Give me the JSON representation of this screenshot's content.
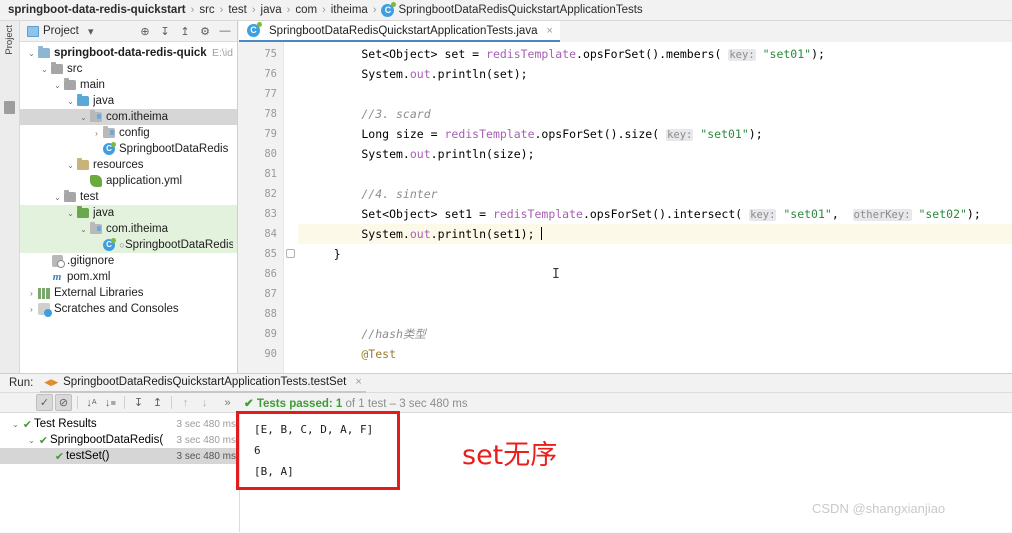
{
  "breadcrumb": {
    "items": [
      {
        "label": "springboot-data-redis-quickstart",
        "bold": true
      },
      {
        "label": "src",
        "bold": false
      },
      {
        "label": "test",
        "bold": false
      },
      {
        "label": "java",
        "bold": false
      },
      {
        "label": "com",
        "bold": false
      },
      {
        "label": "itheima",
        "bold": false
      }
    ],
    "class_icon": "java-class-icon",
    "class_label": "SpringbootDataRedisQuickstartApplicationTests"
  },
  "left_strips": {
    "project_label": "Project",
    "structure_label": "Structure"
  },
  "project_panel": {
    "title": "Project",
    "toolbar": [
      {
        "name": "locate-icon",
        "glyph": "⊕"
      },
      {
        "name": "expand-all-icon",
        "glyph": "↧"
      },
      {
        "name": "collapse-all-icon",
        "glyph": "↥"
      },
      {
        "name": "settings-gear-icon",
        "glyph": "⚙"
      },
      {
        "name": "hide-panel-icon",
        "glyph": "—"
      }
    ],
    "tree": [
      {
        "label": "springboot-data-redis-quickstart",
        "path_suffix": "E:\\id",
        "indent": 0,
        "chev": "v",
        "icon": "module-folder-icon",
        "bold": true,
        "highlight": ""
      },
      {
        "label": "src",
        "indent": 1,
        "chev": "v",
        "icon": "folder-icon",
        "bold": false,
        "highlight": ""
      },
      {
        "label": "main",
        "indent": 2,
        "chev": "v",
        "icon": "folder-icon",
        "bold": false,
        "highlight": ""
      },
      {
        "label": "java",
        "indent": 3,
        "chev": "v",
        "icon": "source-folder-icon",
        "bold": false,
        "highlight": ""
      },
      {
        "label": "com.itheima",
        "indent": 4,
        "chev": "v",
        "icon": "package-icon",
        "bold": false,
        "highlight": "grey"
      },
      {
        "label": "config",
        "indent": 5,
        "chev": ">",
        "icon": "package-icon",
        "bold": false,
        "highlight": ""
      },
      {
        "label": "SpringbootDataRedis",
        "indent": 5,
        "chev": "",
        "icon": "java-class-icon",
        "bold": false,
        "highlight": ""
      },
      {
        "label": "resources",
        "indent": 3,
        "chev": "v",
        "icon": "resources-folder-icon",
        "bold": false,
        "highlight": ""
      },
      {
        "label": "application.yml",
        "indent": 4,
        "chev": "",
        "icon": "yaml-file-icon",
        "bold": false,
        "highlight": ""
      },
      {
        "label": "test",
        "indent": 2,
        "chev": "v",
        "icon": "folder-icon",
        "bold": false,
        "highlight": ""
      },
      {
        "label": "java",
        "indent": 3,
        "chev": "v",
        "icon": "test-source-folder-icon",
        "bold": false,
        "highlight": "green"
      },
      {
        "label": "com.itheima",
        "indent": 4,
        "chev": "v",
        "icon": "package-icon",
        "bold": false,
        "highlight": "green"
      },
      {
        "label": "SpringbootDataRedis",
        "indent": 5,
        "chev": "",
        "icon": "java-test-class-icon",
        "bold": false,
        "highlight": "green"
      },
      {
        "label": ".gitignore",
        "indent": 1,
        "chev": "",
        "icon": "gitignore-file-icon",
        "bold": false,
        "highlight": ""
      },
      {
        "label": "pom.xml",
        "indent": 1,
        "chev": "",
        "icon": "maven-file-icon",
        "bold": false,
        "highlight": ""
      },
      {
        "label": "External Libraries",
        "indent": 0,
        "chev": ">",
        "icon": "library-icon",
        "bold": false,
        "highlight": ""
      },
      {
        "label": "Scratches and Consoles",
        "indent": 0,
        "chev": ">",
        "icon": "scratches-icon",
        "bold": false,
        "highlight": ""
      }
    ]
  },
  "editor": {
    "tab_label": "SpringbootDataRedisQuickstartApplicationTests.java",
    "tab_icon": "java-test-class-icon",
    "tab_close": "×",
    "first_line_number": 75,
    "lines": [
      {
        "n": 75,
        "highlight": false,
        "fold": false,
        "segments": [
          {
            "t": "        Set<Object> set = ",
            "c": "kw"
          },
          {
            "t": "redisTemplate",
            "c": "var"
          },
          {
            "t": ".opsForSet().members( ",
            "c": "kw"
          },
          {
            "t": "key:",
            "c": "hint"
          },
          {
            "t": " ",
            "c": "kw"
          },
          {
            "t": "\"set01\"",
            "c": "str"
          },
          {
            "t": ");",
            "c": "kw"
          }
        ]
      },
      {
        "n": 76,
        "highlight": false,
        "fold": false,
        "segments": [
          {
            "t": "        System.",
            "c": "kw"
          },
          {
            "t": "out",
            "c": "var"
          },
          {
            "t": ".println(set);",
            "c": "kw"
          }
        ]
      },
      {
        "n": 77,
        "highlight": false,
        "fold": false,
        "segments": []
      },
      {
        "n": 78,
        "highlight": false,
        "fold": false,
        "segments": [
          {
            "t": "        //3. scard",
            "c": "cmt"
          }
        ]
      },
      {
        "n": 79,
        "highlight": false,
        "fold": false,
        "segments": [
          {
            "t": "        Long size = ",
            "c": "kw"
          },
          {
            "t": "redisTemplate",
            "c": "var"
          },
          {
            "t": ".opsForSet().size( ",
            "c": "kw"
          },
          {
            "t": "key:",
            "c": "hint"
          },
          {
            "t": " ",
            "c": "kw"
          },
          {
            "t": "\"set01\"",
            "c": "str"
          },
          {
            "t": ");",
            "c": "kw"
          }
        ]
      },
      {
        "n": 80,
        "highlight": false,
        "fold": false,
        "segments": [
          {
            "t": "        System.",
            "c": "kw"
          },
          {
            "t": "out",
            "c": "var"
          },
          {
            "t": ".println(size);",
            "c": "kw"
          }
        ]
      },
      {
        "n": 81,
        "highlight": false,
        "fold": false,
        "segments": []
      },
      {
        "n": 82,
        "highlight": false,
        "fold": false,
        "segments": [
          {
            "t": "        //4. sinter",
            "c": "cmt"
          }
        ]
      },
      {
        "n": 83,
        "highlight": false,
        "fold": false,
        "segments": [
          {
            "t": "        Set<Object> set1 = ",
            "c": "kw"
          },
          {
            "t": "redisTemplate",
            "c": "var"
          },
          {
            "t": ".opsForSet().intersect( ",
            "c": "kw"
          },
          {
            "t": "key:",
            "c": "hint"
          },
          {
            "t": " ",
            "c": "kw"
          },
          {
            "t": "\"set01\"",
            "c": "str"
          },
          {
            "t": ",  ",
            "c": "kw"
          },
          {
            "t": "otherKey:",
            "c": "hint"
          },
          {
            "t": " ",
            "c": "kw"
          },
          {
            "t": "\"set02\"",
            "c": "str"
          },
          {
            "t": ");",
            "c": "kw"
          }
        ]
      },
      {
        "n": 84,
        "highlight": true,
        "fold": false,
        "segments": [
          {
            "t": "        System.",
            "c": "kw"
          },
          {
            "t": "out",
            "c": "var"
          },
          {
            "t": ".println(set1); ",
            "c": "kw"
          },
          {
            "t": "|",
            "c": "caret"
          }
        ]
      },
      {
        "n": 85,
        "highlight": false,
        "fold": true,
        "segments": [
          {
            "t": "    }",
            "c": "kw"
          }
        ]
      },
      {
        "n": 86,
        "highlight": false,
        "fold": false,
        "segments": []
      },
      {
        "n": 87,
        "highlight": false,
        "fold": false,
        "segments": []
      },
      {
        "n": 88,
        "highlight": false,
        "fold": false,
        "segments": []
      },
      {
        "n": 89,
        "highlight": false,
        "fold": false,
        "segments": [
          {
            "t": "        //hash类型",
            "c": "cmt"
          }
        ]
      },
      {
        "n": 90,
        "highlight": false,
        "fold": false,
        "segments": [
          {
            "t": "        @Test",
            "c": "ann"
          }
        ]
      }
    ]
  },
  "run_panel": {
    "run_label": "Run:",
    "tab_label": "SpringbootDataRedisQuickstartApplicationTests.testSet",
    "tab_close": "×",
    "toolbar": [
      {
        "name": "show-passed-toggle",
        "glyph": "✓",
        "pressed": true
      },
      {
        "name": "show-ignored-toggle",
        "glyph": "⊘",
        "pressed": true
      },
      {
        "name": "sort-alphabetically-icon",
        "glyph": "↓"
      },
      {
        "name": "sort-by-duration-icon",
        "glyph": "↓"
      },
      {
        "name": "expand-all-icon",
        "glyph": "↧"
      },
      {
        "name": "collapse-all-icon",
        "glyph": "↥"
      },
      {
        "name": "previous-failed-test-icon",
        "glyph": "↑"
      },
      {
        "name": "next-failed-test-icon",
        "glyph": "↓"
      },
      {
        "name": "more-options-icon",
        "glyph": "»"
      }
    ],
    "status": {
      "check": "✔",
      "prefix": "Tests passed: ",
      "count": "1",
      "suffix": " of 1 test – 3 sec 480 ms"
    },
    "side_icons": [
      {
        "name": "rerun-icon",
        "glyph": "▶"
      },
      {
        "name": "rerun-failed-tests-icon",
        "glyph": "↺"
      },
      {
        "name": "toggle-auto-test-icon",
        "glyph": "◎"
      },
      {
        "name": "stop-icon",
        "glyph": "■"
      },
      {
        "name": "export-test-results-icon",
        "glyph": "▣"
      },
      {
        "name": "debug-icon",
        "glyph": "✶"
      },
      {
        "name": "settings-icon",
        "glyph": "⚙"
      }
    ],
    "test_tree": [
      {
        "label": "Test Results",
        "time": "3 sec 480 ms",
        "indent": 0,
        "chev": "v",
        "selected": false,
        "dark_time": false
      },
      {
        "label": "SpringbootDataRedis(",
        "time": "3 sec 480 ms",
        "indent": 1,
        "chev": "v",
        "selected": false,
        "dark_time": false
      },
      {
        "label": "testSet()",
        "time": "3 sec 480 ms",
        "indent": 2,
        "chev": "",
        "selected": true,
        "dark_time": true
      }
    ],
    "console_lines": [
      "[E, B, C, D, A, F]",
      "6",
      "[B, A]"
    ]
  },
  "annotations": {
    "red_box_name": "console-output-highlight-box",
    "red_box_color": "#e01c1c",
    "callout_text": "set无序",
    "callout_color": "#e8201c",
    "watermark": "CSDN @shangxianjiao"
  }
}
